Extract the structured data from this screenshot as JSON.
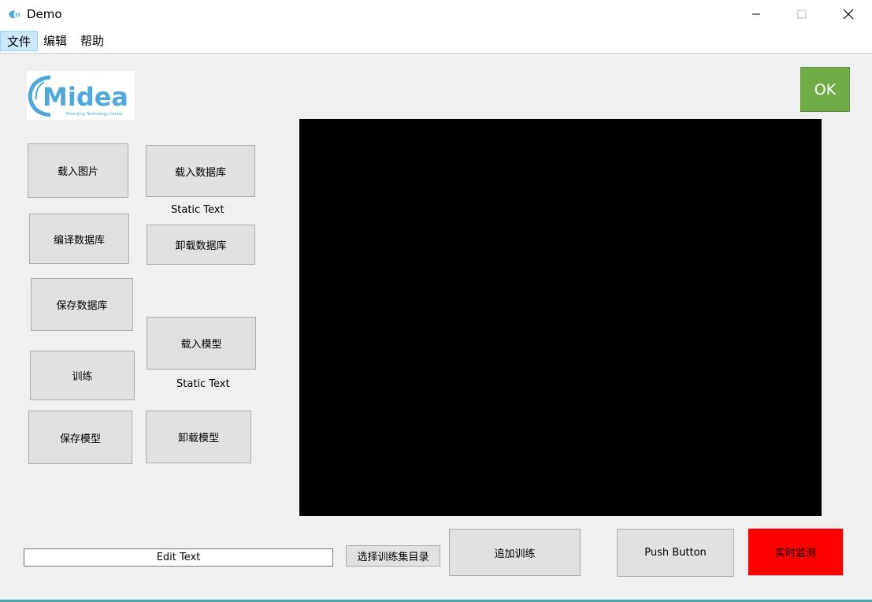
{
  "window": {
    "title": "Demo"
  },
  "menu": {
    "items": [
      "文件",
      "编辑",
      "帮助"
    ]
  },
  "logo": {
    "brand": "Midea",
    "tagline": "Emerging Technology Center"
  },
  "buttons": {
    "load_image": "载入图片",
    "load_database": "载入数据库",
    "compile_database": "编译数据库",
    "unload_database": "卸载数据库",
    "save_database": "保存数据库",
    "load_model": "载入模型",
    "train": "训练",
    "save_model": "保存模型",
    "unload_model": "卸载模型",
    "ok": "OK",
    "select_train_dir": "选择训练集目录",
    "append_train": "追加训练",
    "push_button": "Push Button",
    "realtime_monitor": "实时监测"
  },
  "static_texts": {
    "text1": "Static Text",
    "text2": "Static Text"
  },
  "edit_text": {
    "value": "Edit Text"
  },
  "colors": {
    "ok_bg": "#70ad47",
    "monitor_bg": "#ff0000",
    "display_bg": "#000000",
    "logo_blue": "#4fa8d9"
  }
}
